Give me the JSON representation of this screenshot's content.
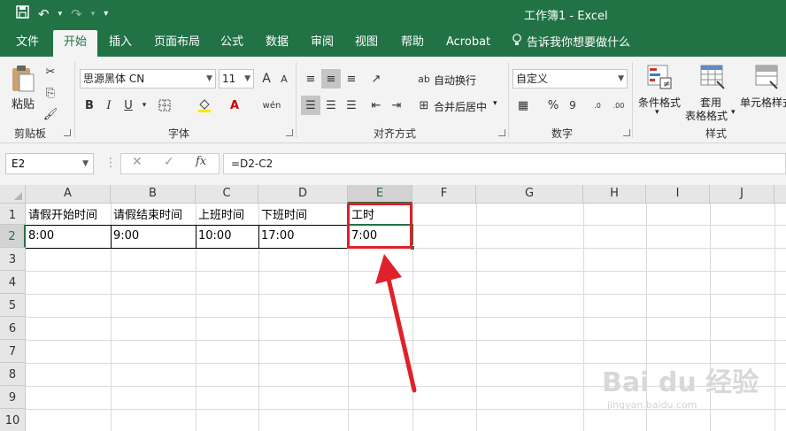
{
  "titlebar": {
    "save_icon": "save-icon",
    "undo_glyph": "↶",
    "redo_glyph": "↷",
    "customize_glyph": "▾",
    "title": "工作簿1  -  Excel"
  },
  "menu": {
    "tabs": [
      "文件",
      "开始",
      "插入",
      "页面布局",
      "公式",
      "数据",
      "审阅",
      "视图",
      "帮助",
      "Acrobat"
    ],
    "active_tab": "开始",
    "tell_me": "告诉我你想要做什么"
  },
  "ribbon": {
    "clipboard": {
      "paste_label": "粘贴",
      "group_label": "剪贴板"
    },
    "font": {
      "font_name": "思源黑体 CN",
      "font_size": "11",
      "grow_glyph": "A",
      "shrink_glyph": "A",
      "bold": "B",
      "italic": "I",
      "underline": "U",
      "wen_glyph": "wén",
      "group_label": "字体"
    },
    "alignment": {
      "wrap_text": "自动换行",
      "merge_center": "合并后居中",
      "group_label": "对齐方式"
    },
    "number": {
      "format": "自定义",
      "percent": "%",
      "comma": "9",
      "inc_dec": ".00→.0",
      "group_label": "数字"
    },
    "styles": {
      "conditional": "条件格式",
      "table_line1": "套用",
      "table_line2": "表格格式",
      "cell_styles": "单元格样式",
      "group_label": "样式"
    }
  },
  "formula_bar": {
    "name_box": "E2",
    "cancel_glyph": "✕",
    "enter_glyph": "✓",
    "fx_glyph": "fx",
    "formula": "=D2-C2"
  },
  "sheet": {
    "columns": [
      "A",
      "B",
      "C",
      "D",
      "E",
      "F",
      "G",
      "H",
      "I",
      "J"
    ],
    "selected_column": "E",
    "rows": [
      "1",
      "2",
      "3",
      "4",
      "5",
      "6",
      "7",
      "8",
      "9",
      "10"
    ],
    "selected_row": "2",
    "header_row": [
      "请假开始时间",
      "请假结束时间",
      "上班时间",
      "下班时间",
      "工时"
    ],
    "data_row": [
      "8:00",
      "9:00",
      "10:00",
      "17:00",
      "7:00"
    ]
  },
  "colors": {
    "excel_green": "#217346",
    "annotation_red": "#e0202a"
  },
  "watermark": {
    "brand": "Bai du 经验",
    "url": "jingyan.baidu.com"
  }
}
